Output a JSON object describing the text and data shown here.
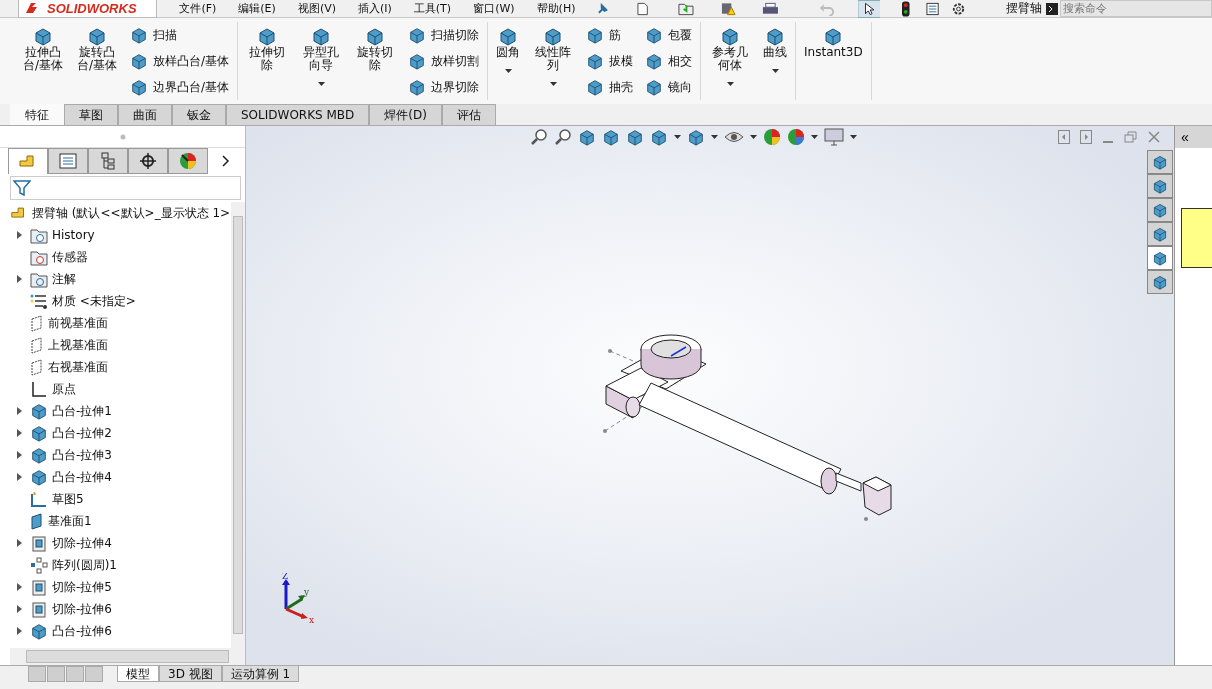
{
  "logo": "SOLIDWORKS",
  "menu": [
    "文件(F)",
    "编辑(E)",
    "视图(V)",
    "插入(I)",
    "工具(T)",
    "窗口(W)",
    "帮助(H)"
  ],
  "document_title": "摆臂轴",
  "search": {
    "placeholder": "搜索命令"
  },
  "ribbon": [
    {
      "columns": [
        {
          "kind": "large",
          "items": [
            {
              "label": "拉伸凸台/基体",
              "dropdown": false
            }
          ]
        },
        {
          "kind": "large",
          "items": [
            {
              "label": "旋转凸台/基体",
              "dropdown": false
            }
          ]
        },
        {
          "kind": "small",
          "items": [
            {
              "label": "扫描"
            },
            {
              "label": "放样凸台/基体"
            },
            {
              "label": "边界凸台/基体"
            }
          ]
        }
      ]
    },
    {
      "columns": [
        {
          "kind": "large",
          "items": [
            {
              "label": "拉伸切除",
              "dropdown": false
            }
          ]
        },
        {
          "kind": "large",
          "items": [
            {
              "label": "异型孔向导",
              "dropdown": true
            }
          ]
        },
        {
          "kind": "large",
          "items": [
            {
              "label": "旋转切除",
              "dropdown": false
            }
          ]
        },
        {
          "kind": "small",
          "items": [
            {
              "label": "扫描切除"
            },
            {
              "label": "放样切割"
            },
            {
              "label": "边界切除"
            }
          ]
        }
      ]
    },
    {
      "columns": [
        {
          "kind": "large",
          "items": [
            {
              "label": "圆角",
              "dropdown": true
            }
          ]
        },
        {
          "kind": "large",
          "items": [
            {
              "label": "线性阵列",
              "dropdown": true
            }
          ]
        },
        {
          "kind": "small",
          "items": [
            {
              "label": "筋"
            },
            {
              "label": "拔模"
            },
            {
              "label": "抽壳"
            }
          ]
        },
        {
          "kind": "small",
          "items": [
            {
              "label": "包覆"
            },
            {
              "label": "相交"
            },
            {
              "label": "镜向"
            }
          ]
        }
      ]
    },
    {
      "columns": [
        {
          "kind": "large",
          "items": [
            {
              "label": "参考几何体",
              "dropdown": true
            }
          ]
        },
        {
          "kind": "large",
          "items": [
            {
              "label": "曲线",
              "dropdown": true
            }
          ]
        }
      ]
    },
    {
      "columns": [
        {
          "kind": "large",
          "items": [
            {
              "label": "Instant3D",
              "dropdown": false
            }
          ]
        }
      ]
    }
  ],
  "command_tabs": [
    {
      "label": "特征",
      "selected": true
    },
    {
      "label": "草图",
      "selected": false
    },
    {
      "label": "曲面",
      "selected": false
    },
    {
      "label": "钣金",
      "selected": false
    },
    {
      "label": "SOLIDWORKS MBD",
      "selected": false
    },
    {
      "label": "焊件(D)",
      "selected": false
    },
    {
      "label": "评估",
      "selected": false
    }
  ],
  "manager_tabs": [
    {
      "selected": true
    },
    {
      "selected": false
    },
    {
      "selected": false
    },
    {
      "selected": false
    },
    {
      "selected": false
    }
  ],
  "feature_tree": {
    "root": "摆臂轴  (默认<<默认>_显示状态 1>",
    "items": [
      {
        "label": "History",
        "kind": "history",
        "expandable": true
      },
      {
        "label": "传感器",
        "kind": "sensor",
        "expandable": false
      },
      {
        "label": "注解",
        "kind": "annotation",
        "expandable": true
      },
      {
        "label": "材质 <未指定>",
        "kind": "material",
        "expandable": false
      },
      {
        "label": "前视基准面",
        "kind": "plane",
        "expandable": false
      },
      {
        "label": "上视基准面",
        "kind": "plane",
        "expandable": false
      },
      {
        "label": "右视基准面",
        "kind": "plane",
        "expandable": false
      },
      {
        "label": "原点",
        "kind": "origin",
        "expandable": false
      },
      {
        "label": "凸台-拉伸1",
        "kind": "boss",
        "expandable": true
      },
      {
        "label": "凸台-拉伸2",
        "kind": "boss",
        "expandable": true
      },
      {
        "label": "凸台-拉伸3",
        "kind": "boss",
        "expandable": true
      },
      {
        "label": "凸台-拉伸4",
        "kind": "boss",
        "expandable": true
      },
      {
        "label": "草图5",
        "kind": "sketch",
        "expandable": false
      },
      {
        "label": "基准面1",
        "kind": "datum",
        "expandable": false
      },
      {
        "label": "切除-拉伸4",
        "kind": "cut",
        "expandable": true
      },
      {
        "label": "阵列(圆周)1",
        "kind": "pattern",
        "expandable": false
      },
      {
        "label": "切除-拉伸5",
        "kind": "cut",
        "expandable": true
      },
      {
        "label": "切除-拉伸6",
        "kind": "cut",
        "expandable": true
      },
      {
        "label": "凸台-拉伸6",
        "kind": "boss",
        "expandable": true
      }
    ]
  },
  "triad": {
    "z": "Z",
    "y": "y",
    "x": "x"
  },
  "model_tabs": [
    {
      "label": "模型",
      "selected": true
    },
    {
      "label": "3D 视图",
      "selected": false
    },
    {
      "label": "运动算例 1",
      "selected": false
    }
  ],
  "task_pane_tabs": [
    {
      "selected": false
    },
    {
      "selected": false
    },
    {
      "selected": false
    },
    {
      "selected": false
    },
    {
      "selected": true
    },
    {
      "selected": false
    }
  ],
  "task_pane": {
    "collapse": "«"
  }
}
